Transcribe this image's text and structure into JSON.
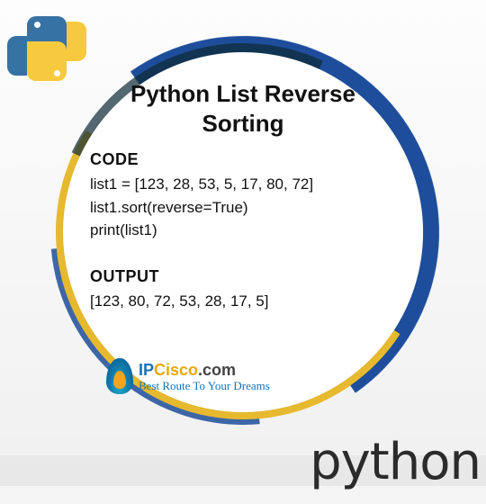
{
  "title": "Python List Reverse Sorting",
  "sections": {
    "code_label": "CODE",
    "output_label": "OUTPUT"
  },
  "code": {
    "line1": "list1 = [123, 28, 53, 5, 17, 80, 72]",
    "line2": "list1.sort(reverse=True)",
    "line3": "print(list1)"
  },
  "output": {
    "line1": "[123, 80, 72, 53, 28, 17, 5]"
  },
  "brand": {
    "name_ip": "IP",
    "name_cisco": "Cisco",
    "name_com": ".com",
    "tagline": "Best Route To Your Dreams"
  },
  "footer": {
    "python_word": "python"
  },
  "icons": {
    "python_logo": "python-logo",
    "flame": "flame-icon"
  },
  "colors": {
    "brush_blue": "#1e4e9b",
    "brush_yellow": "#e7b92e",
    "brand_blue": "#1472b8",
    "brand_gold": "#e8a90f"
  }
}
